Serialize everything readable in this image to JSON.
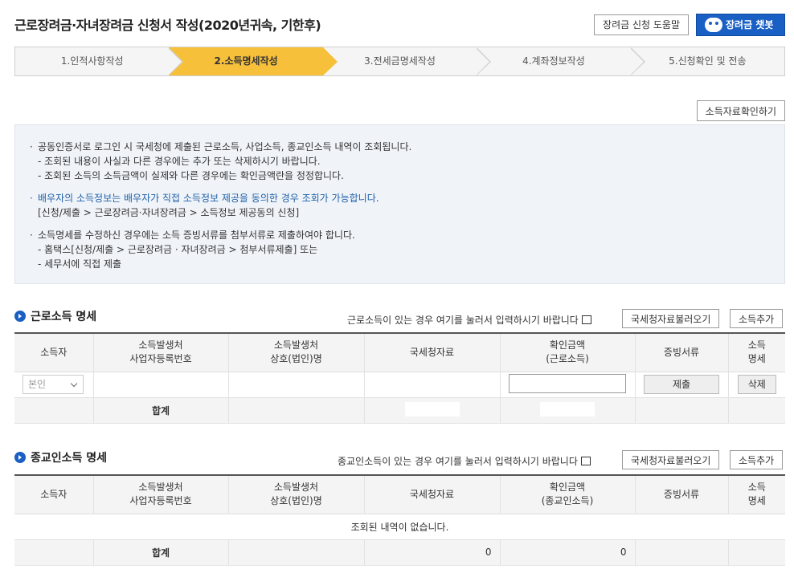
{
  "header": {
    "title": "근로장려금·자녀장려금 신청서 작성(2020년귀속, 기한후)",
    "help_label": "장려금 신청 도움말",
    "chat_label": "장려금 챗봇"
  },
  "steps": [
    {
      "label": "1.인적사항작성"
    },
    {
      "label": "2.소득명세작성"
    },
    {
      "label": "3.전세금명세작성"
    },
    {
      "label": "4.계좌정보작성"
    },
    {
      "label": "5.신청확인 및 전송"
    }
  ],
  "active_step": 2,
  "confirm_button": "소득자료확인하기",
  "notice": {
    "g1": [
      "공동인증서로 로그인 시 국세청에 제출된 근로소득, 사업소득, 종교인소득 내역이 조회됩니다.",
      "- 조회된 내용이 사실과 다른 경우에는 추가 또는 삭제하시기 바랍니다.",
      "- 조회된 소득의 소득금액이 실제와 다른 경우에는 확인금액란을 정정합니다."
    ],
    "g2": [
      "배우자의 소득정보는 배우자가 직접 소득정보 제공을 동의한 경우 조회가 가능합니다.",
      "[신청/제출 > 근로장려금·자녀장려금 > 소득정보 제공동의 신청]"
    ],
    "g3": [
      "소득명세를 수정하신 경우에는 소득 증빙서류를 첨부서류로 제출하여야 합니다.",
      "- 홈택스[신청/제출 > 근로장려금 · 자녀장려금 > 첨부서류제출] 또는",
      "- 세무서에 직접 제출"
    ]
  },
  "earned": {
    "title": "근로소득 명세",
    "hint": "근로소득이 있는 경우 여기를 눌러서 입력하시기 바랍니다",
    "load_button": "국세청자료불러오기",
    "add_button": "소득추가",
    "headers": [
      "소득자",
      "소득발생처\n사업자등록번호",
      "소득발생처\n상호(법인)명",
      "국세청자료",
      "확인금액\n(근로소득)",
      "증빙서류",
      "소득\n명세"
    ],
    "row": {
      "person_select": "본인",
      "submit_button": "제출",
      "delete_button": "삭제"
    },
    "total_label": "합계"
  },
  "religious": {
    "title": "종교인소득 명세",
    "hint": "종교인소득이 있는 경우 여기를 눌러서 입력하시기 바랍니다",
    "load_button": "국세청자료불러오기",
    "add_button": "소득추가",
    "headers": [
      "소득자",
      "소득발생처\n사업자등록번호",
      "소득발생처\n상호(법인)명",
      "국세청자료",
      "확인금액\n(종교인소득)",
      "증빙서류",
      "소득\n명세"
    ],
    "empty_message": "조회된 내역이 없습니다.",
    "total_label": "합계",
    "total_nts": "0",
    "total_confirm": "0"
  },
  "colors": {
    "accent": "#1a5fc4",
    "step_active": "#f7c03a",
    "notice_bg": "#f0f4f9"
  }
}
